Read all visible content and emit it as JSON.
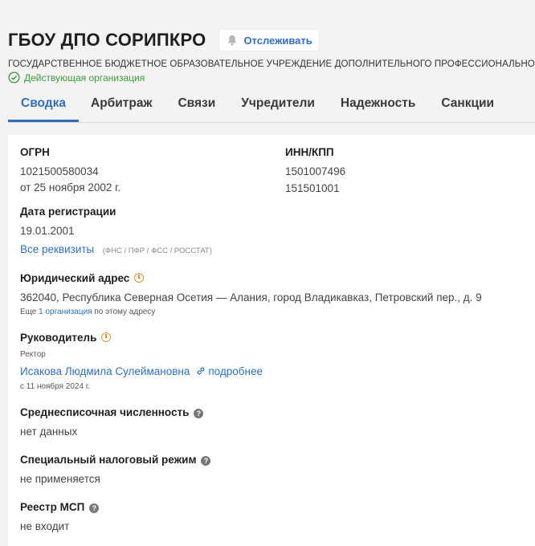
{
  "header": {
    "org_title": "ГБОУ ДПО СОРИПКРО",
    "follow_label": "Отслеживать",
    "full_name": "ГОСУДАРСТВЕННОЕ БЮДЖЕТНОЕ ОБРАЗОВАТЕЛЬНОЕ УЧРЕЖДЕНИЕ ДОПОЛНИТЕЛЬНОГО ПРОФЕССИОНАЛЬНОГО",
    "status": "Действующая организация"
  },
  "tabs": [
    {
      "label": "Сводка"
    },
    {
      "label": "Арбитраж"
    },
    {
      "label": "Связи"
    },
    {
      "label": "Учредители"
    },
    {
      "label": "Надежность"
    },
    {
      "label": "Санкции"
    }
  ],
  "summary": {
    "ogrn_label": "ОГРН",
    "ogrn_value": "1021500580034",
    "ogrn_date": "от 25 ноября 2002 г.",
    "inn_label": "ИНН/КПП",
    "inn_value": "1501007496",
    "kpp_value": "151501001",
    "reg_label": "Дата регистрации",
    "reg_value": "19.01.2001",
    "requisites_link": "Все реквизиты",
    "requisites_note": "(ФНС / ПФР / ФСС / РОССТАТ)",
    "address_label": "Юридический адрес",
    "address_value": "362040, Республика Северная Осетия — Алания, город Владикавказ, Петровский пер., д. 9",
    "address_more_prefix": "Еще",
    "address_more_link": "1 организация",
    "address_more_suffix": "по этому адресу",
    "head_label": "Руководитель",
    "head_role": "Ректор",
    "head_name": "Исакова Людмила Сулеймановна",
    "head_more": "подробнее",
    "head_since": "с 11 ноября 2024 г.",
    "staff_label": "Среднесписочная численность",
    "staff_value": "нет данных",
    "tax_label": "Специальный налоговый режим",
    "tax_value": "не применяется",
    "msp_label": "Реестр МСП",
    "msp_value": "не входит"
  },
  "colors": {
    "accent": "#2f6fc1",
    "status_green": "#3b9b3b",
    "clock_orange": "#e0912d"
  },
  "icons": [
    "bell-icon",
    "check-circle-icon",
    "clock-icon",
    "question-icon",
    "link-icon"
  ]
}
